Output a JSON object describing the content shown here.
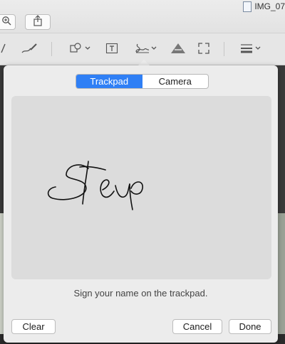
{
  "window": {
    "filename": "IMG_07"
  },
  "toolbar": {
    "icons": [
      "zoom-in-icon",
      "share-icon",
      "pen-icon",
      "sketch-icon",
      "shapes-icon",
      "text-icon",
      "signature-icon",
      "adjust-color-icon",
      "adjust-size-icon",
      "shape-style-icon"
    ]
  },
  "signature_popover": {
    "tabs": [
      {
        "label": "Trackpad",
        "active": true
      },
      {
        "label": "Camera",
        "active": false
      }
    ],
    "instruction": "Sign your name on the trackpad.",
    "buttons": {
      "clear": "Clear",
      "cancel": "Cancel",
      "done": "Done"
    }
  },
  "colors": {
    "accent": "#2f7ff5",
    "popover_bg": "#ececec",
    "pad_bg": "#dcdcdc"
  }
}
